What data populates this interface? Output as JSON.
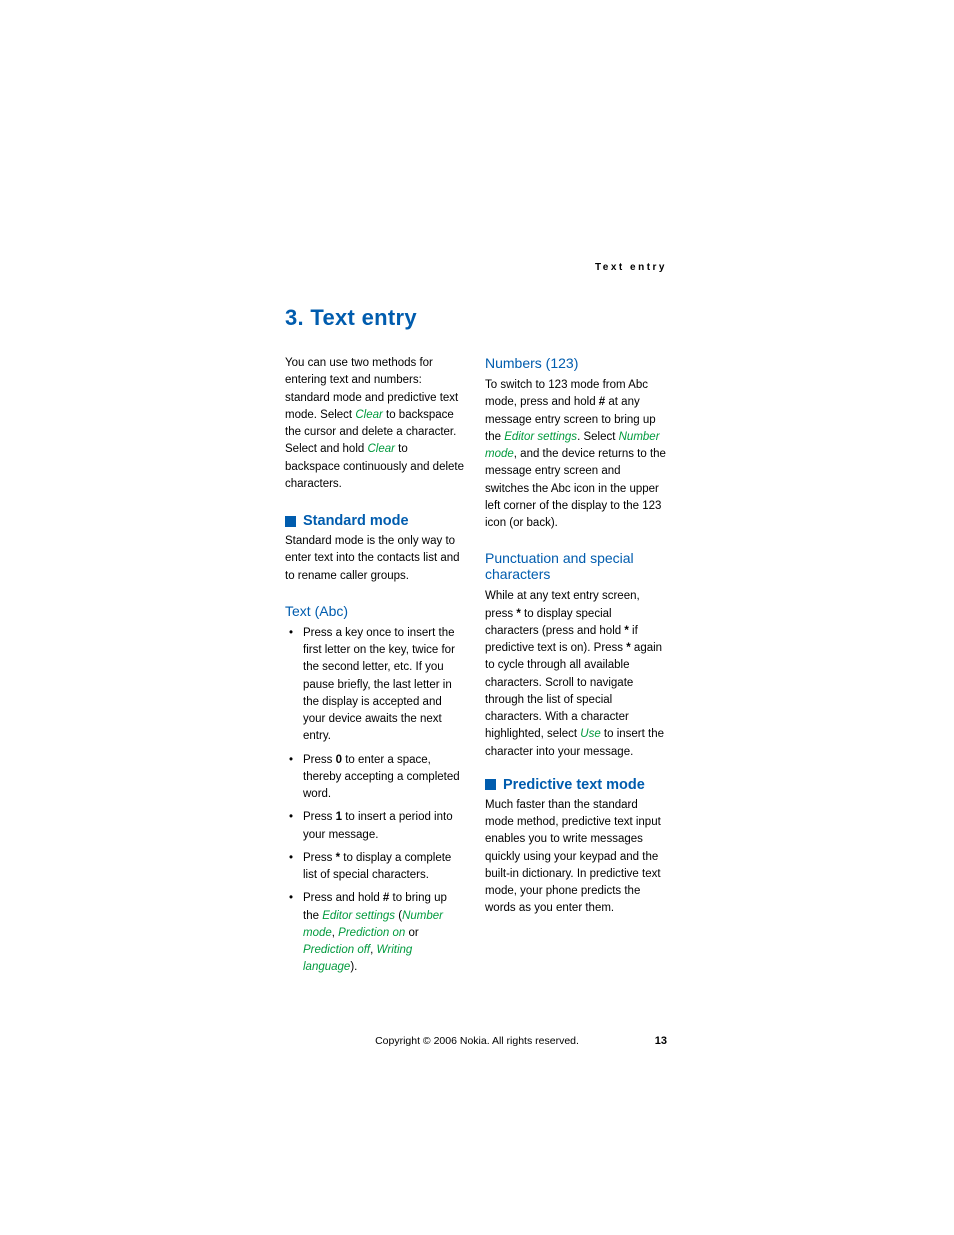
{
  "runningHead": "Text entry",
  "chapterTitle": "3.  Text entry",
  "intro": {
    "pre": "You can use two methods for entering text and numbers: standard mode and predictive text mode. Select ",
    "clear1": "Clear",
    "mid": " to backspace the cursor and delete a character. Select and hold ",
    "clear2": "Clear",
    "post": " to backspace continuously and delete characters."
  },
  "standard": {
    "heading": "Standard mode",
    "body": "Standard mode is the only way to enter text into the contacts list and to rename caller groups."
  },
  "textAbc": {
    "heading": "Text (Abc)",
    "b1": "Press a key once to insert the first letter on the key, twice for the second letter, etc. If you pause briefly, the last letter in the display is accepted and your device awaits the next entry.",
    "b2_pre": "Press ",
    "b2_key": "0",
    "b2_post": " to enter a space, thereby accepting a completed word.",
    "b3_pre": "Press ",
    "b3_key": "1",
    "b3_post": " to insert a period into your message.",
    "b4_pre": "Press ",
    "b4_key": "*",
    "b4_post": " to display a complete list of special characters.",
    "b5_pre": "Press and hold ",
    "b5_key": "#",
    "b5_post": " to bring up the ",
    "b5_es": "Editor settings",
    "b5_paren_open": " (",
    "b5_nm": "Number mode",
    "b5_sep1": ", ",
    "b5_pon": "Prediction on",
    "b5_sep2": " or ",
    "b5_poff": "Prediction off",
    "b5_sep3": ", ",
    "b5_wl": "Writing language",
    "b5_paren_close": ")."
  },
  "numbers": {
    "heading": "Numbers (123)",
    "p_pre": "To switch to 123 mode from Abc mode, press and hold ",
    "p_key": "#",
    "p_mid1": " at any message entry screen to bring up the ",
    "p_es": "Editor settings",
    "p_mid2": ". Select ",
    "p_nm": "Number mode",
    "p_post": ", and the device returns to the message entry screen and switches the Abc icon in the upper left corner of the display to the 123 icon (or back)."
  },
  "punct": {
    "heading": "Punctuation and special characters",
    "p_pre": "While at any text entry screen, press ",
    "p_key1": "*",
    "p_mid1": " to display special characters (press and hold ",
    "p_key2": "*",
    "p_mid2": " if predictive text is on). Press ",
    "p_key3": "*",
    "p_mid3": " again to cycle through all available characters. Scroll to navigate through the list of special characters. With a character highlighted, select ",
    "p_use": "Use",
    "p_post": " to insert the character into your message."
  },
  "predictive": {
    "heading": "Predictive text mode",
    "body": "Much faster than the standard mode method, predictive text input enables you to write messages quickly using your keypad and the built-in dictionary. In predictive text mode, your phone predicts the words as you enter them."
  },
  "footer": "Copyright © 2006 Nokia. All rights reserved.",
  "pageNum": "13"
}
